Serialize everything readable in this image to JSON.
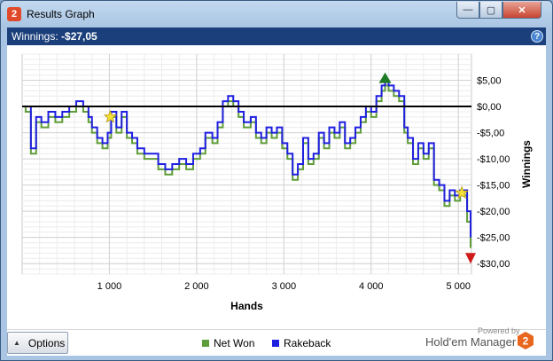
{
  "window": {
    "title": "Results Graph",
    "app_icon_label": "2",
    "minimize_glyph": "—",
    "maximize_glyph": "▢",
    "close_glyph": "✕"
  },
  "header": {
    "label": "Winnings:",
    "value": "-$27,05",
    "help_glyph": "?"
  },
  "chart_data": {
    "type": "line",
    "xlabel": "Hands",
    "ylabel": "Winnings",
    "xlim": [
      0,
      5150
    ],
    "ylim": [
      -32,
      10
    ],
    "x_ticks": [
      1000,
      2000,
      3000,
      4000,
      5000
    ],
    "x_tick_labels": [
      "1 000",
      "2 000",
      "3 000",
      "4 000",
      "5 000"
    ],
    "y_ticks": [
      5,
      0,
      -5,
      -10,
      -15,
      -20,
      -25,
      -30
    ],
    "y_tick_labels": [
      "$5,00",
      "$0,00",
      "-$5,00",
      "-$10,00",
      "-$15,00",
      "-$20,00",
      "-$25,00",
      "-$30,00"
    ],
    "grid": true,
    "zero_line": true,
    "legend_position": "bottom-center",
    "colors": {
      "net_won": "#5f9d3a",
      "rakeback": "#1f1fe0",
      "peak_marker": "#1e7a25",
      "low_marker": "#d01a1a",
      "star": "#f4e03a"
    },
    "series": [
      {
        "name": "Net Won",
        "x": [
          0,
          40,
          100,
          160,
          220,
          300,
          380,
          460,
          540,
          620,
          700,
          760,
          800,
          860,
          920,
          980,
          1020,
          1080,
          1140,
          1200,
          1260,
          1320,
          1400,
          1480,
          1560,
          1640,
          1720,
          1800,
          1880,
          1960,
          2040,
          2100,
          2180,
          2240,
          2300,
          2360,
          2420,
          2480,
          2540,
          2620,
          2680,
          2740,
          2800,
          2860,
          2920,
          2980,
          3040,
          3100,
          3160,
          3220,
          3280,
          3340,
          3400,
          3460,
          3520,
          3580,
          3640,
          3700,
          3760,
          3820,
          3880,
          3940,
          4000,
          4060,
          4120,
          4160,
          4200,
          4260,
          4320,
          4380,
          4420,
          4480,
          4540,
          4600,
          4660,
          4720,
          4780,
          4840,
          4900,
          4960,
          5020,
          5060,
          5100,
          5140
        ],
        "values": [
          0,
          -1,
          -9,
          -3,
          -4,
          -2,
          -3,
          -2,
          -1,
          0,
          -1,
          -3,
          -5,
          -7,
          -8,
          -6,
          -2,
          -5,
          -2,
          -6,
          -7,
          -9,
          -10,
          -10,
          -12,
          -13,
          -12,
          -11,
          -12,
          -10,
          -9,
          -6,
          -7,
          -4,
          0,
          1,
          0,
          -2,
          -4,
          -3,
          -6,
          -7,
          -5,
          -6,
          -5,
          -8,
          -10,
          -14,
          -12,
          -7,
          -11,
          -10,
          -6,
          -8,
          -5,
          -6,
          -4,
          -8,
          -7,
          -5,
          -3,
          -1,
          -2,
          1,
          3,
          4,
          3,
          2,
          1,
          -5,
          -7,
          -11,
          -8,
          -10,
          -8,
          -15,
          -16,
          -19,
          -17,
          -18,
          -17,
          -17,
          -22,
          -27
        ]
      },
      {
        "name": "Rakeback",
        "x": [
          0,
          40,
          100,
          160,
          220,
          300,
          380,
          460,
          540,
          620,
          700,
          760,
          800,
          860,
          920,
          980,
          1020,
          1080,
          1140,
          1200,
          1260,
          1320,
          1400,
          1480,
          1560,
          1640,
          1720,
          1800,
          1880,
          1960,
          2040,
          2100,
          2180,
          2240,
          2300,
          2360,
          2420,
          2480,
          2540,
          2620,
          2680,
          2740,
          2800,
          2860,
          2920,
          2980,
          3040,
          3100,
          3160,
          3220,
          3280,
          3340,
          3400,
          3460,
          3520,
          3580,
          3640,
          3700,
          3760,
          3820,
          3880,
          3940,
          4000,
          4060,
          4120,
          4160,
          4200,
          4260,
          4320,
          4380,
          4420,
          4480,
          4540,
          4600,
          4660,
          4720,
          4780,
          4840,
          4900,
          4960,
          5020,
          5060,
          5100,
          5140
        ],
        "values": [
          0,
          0,
          -8,
          -2,
          -3,
          -1,
          -2,
          -1,
          0,
          1,
          0,
          -2,
          -4,
          -6,
          -7,
          -5,
          -1,
          -4,
          -1,
          -5,
          -6,
          -8,
          -9,
          -9,
          -11,
          -12,
          -11,
          -10,
          -11,
          -9,
          -8,
          -5,
          -6,
          -3,
          1,
          2,
          1,
          -1,
          -3,
          -2,
          -5,
          -6,
          -4,
          -5,
          -4,
          -7,
          -9,
          -13,
          -11,
          -6,
          -10,
          -9,
          -5,
          -7,
          -4,
          -5,
          -3,
          -7,
          -6,
          -4,
          -2,
          0,
          -1,
          2,
          4,
          5,
          4,
          3,
          2,
          -4,
          -6,
          -10,
          -7,
          -9,
          -7,
          -14,
          -15,
          -18,
          -16,
          -17,
          -16,
          -16,
          -20,
          -25
        ]
      }
    ],
    "markers": [
      {
        "kind": "star",
        "x": 1010,
        "y": -2
      },
      {
        "kind": "star",
        "x": 5040,
        "y": -16.5
      },
      {
        "kind": "peak",
        "x": 4160,
        "y": 5.5
      },
      {
        "kind": "low",
        "x": 5140,
        "y": -29
      }
    ]
  },
  "footer": {
    "options_label": "Options",
    "options_arrow": "▲",
    "legend_net": "Net Won",
    "legend_rake": "Rakeback",
    "powered_by": "Powered by",
    "brand": "Hold'em Manager",
    "brand_logo_label": "2"
  }
}
